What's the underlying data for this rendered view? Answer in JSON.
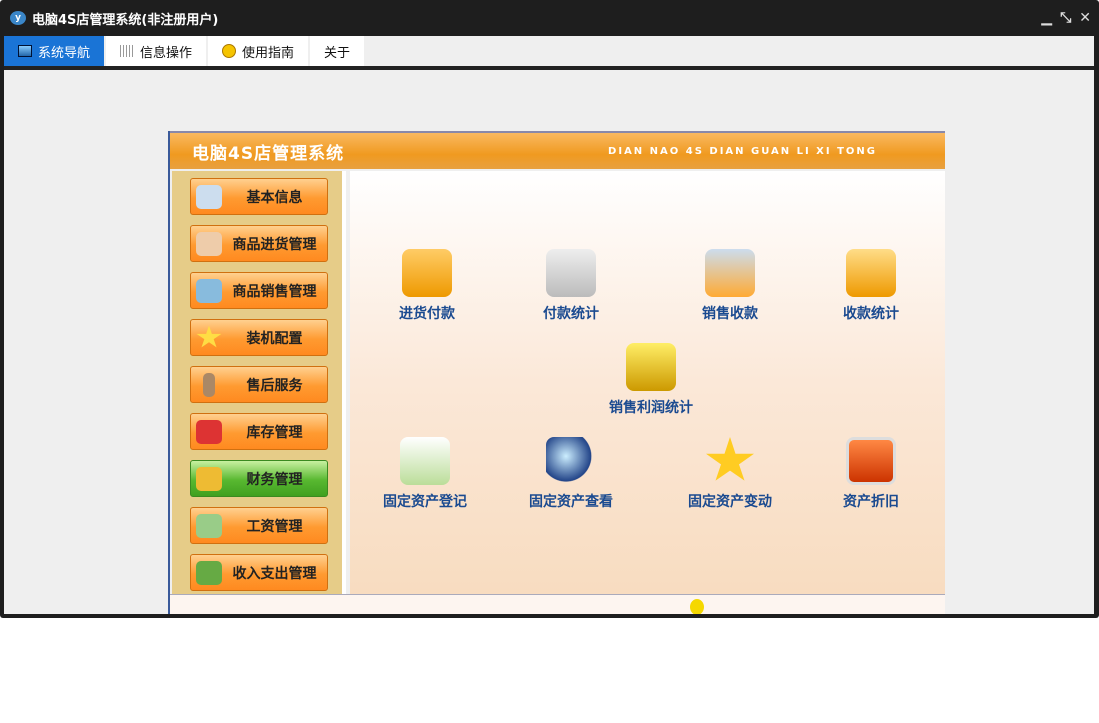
{
  "window": {
    "title": "电脑4S店管理系统(非注册用户)",
    "controls": [
      "minimize",
      "restore",
      "close"
    ]
  },
  "tabs": [
    {
      "label": "系统导航",
      "icon": "monitor-icon",
      "active": true
    },
    {
      "label": "信息操作",
      "icon": "grid-icon"
    },
    {
      "label": "使用指南",
      "icon": "help-icon"
    },
    {
      "label": "关于"
    }
  ],
  "banner": {
    "title": "电脑4S店管理系统",
    "subtitle": "DIAN NAO 4S DIAN GUAN LI XI TONG"
  },
  "sidebar": [
    {
      "label": "基本信息"
    },
    {
      "label": "商品进货管理"
    },
    {
      "label": "商品销售管理"
    },
    {
      "label": "装机配置"
    },
    {
      "label": "售后服务"
    },
    {
      "label": "库存管理"
    },
    {
      "label": "财务管理",
      "active": true
    },
    {
      "label": "工资管理"
    },
    {
      "label": "收入支出管理"
    }
  ],
  "functions": [
    {
      "label": "进货付款"
    },
    {
      "label": "付款统计"
    },
    {
      "label": "销售收款"
    },
    {
      "label": "收款统计"
    },
    {
      "label": "销售利润统计"
    },
    {
      "label": "固定资产登记"
    },
    {
      "label": "固定资产查看"
    },
    {
      "label": "固定资产变动"
    },
    {
      "label": "资产折旧"
    }
  ]
}
